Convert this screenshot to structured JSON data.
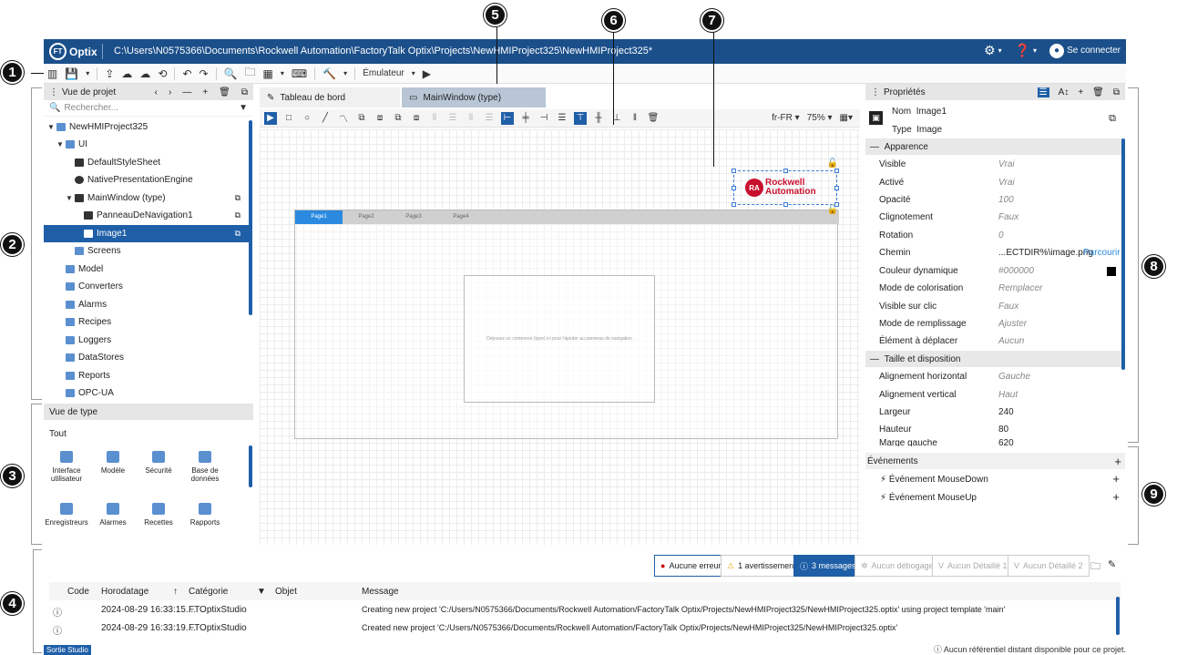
{
  "app": {
    "logo_text": "Optix",
    "logo_badge": "FT",
    "title": "C:\\Users\\N0575366\\Documents\\Rockwell Automation\\FactoryTalk Optix\\Projects\\NewHMIProject325\\NewHMIProject325*",
    "login_label": "Se connecter"
  },
  "toolbar": {
    "emulator_label": "Émulateur"
  },
  "callouts": [
    "1",
    "2",
    "3",
    "4",
    "5",
    "6",
    "7",
    "8",
    "9"
  ],
  "project_view": {
    "title": "Vue de projet",
    "search_placeholder": "Rechercher...",
    "tree": [
      {
        "label": "NewHMIProject325"
      },
      {
        "label": "UI"
      },
      {
        "label": "DefaultStyleSheet"
      },
      {
        "label": "NativePresentationEngine"
      },
      {
        "label": "MainWindow (type)"
      },
      {
        "label": "PanneauDeNavigation1"
      },
      {
        "label": "Image1"
      },
      {
        "label": "Screens"
      },
      {
        "label": "Model"
      },
      {
        "label": "Converters"
      },
      {
        "label": "Alarms"
      },
      {
        "label": "Recipes"
      },
      {
        "label": "Loggers"
      },
      {
        "label": "DataStores"
      },
      {
        "label": "Reports"
      },
      {
        "label": "OPC-UA"
      }
    ]
  },
  "type_view": {
    "title": "Vue de type",
    "filter": "Tout",
    "items": [
      {
        "label": "Interface utilisateur"
      },
      {
        "label": "Modèle"
      },
      {
        "label": "Sécurité"
      },
      {
        "label": "Base de données"
      },
      {
        "label": "Enregistreurs"
      },
      {
        "label": "Alarmes"
      },
      {
        "label": "Recettes"
      },
      {
        "label": "Rapports"
      }
    ]
  },
  "editor": {
    "tabs": [
      {
        "label": "Tableau de bord",
        "active": false
      },
      {
        "label": "MainWindow (type)",
        "active": true
      }
    ],
    "locale": "fr-FR",
    "zoom": "75%",
    "nav_tabs": [
      "Page1",
      "Page2",
      "Page3",
      "Page4"
    ],
    "drop_hint": "Déposez un conteneur (type) ici pour l'ajouter au panneau de navigation",
    "logo_line1": "Rockwell",
    "logo_line2": "Automation",
    "logo_badge": "RA"
  },
  "properties": {
    "title": "Propriétés",
    "name_label": "Nom",
    "name_value": "Image1",
    "type_label": "Type",
    "type_value": "Image",
    "group_appearance": "Apparence",
    "appearance": [
      {
        "name": "Visible",
        "value": "Vrai"
      },
      {
        "name": "Activé",
        "value": "Vrai"
      },
      {
        "name": "Opacité",
        "value": "100"
      },
      {
        "name": "Clignotement",
        "value": "Faux"
      },
      {
        "name": "Rotation",
        "value": "0"
      },
      {
        "name": "Chemin",
        "value": "...ECTDIR%\\image.png"
      },
      {
        "name": "Couleur dynamique",
        "value": "#000000"
      },
      {
        "name": "Mode de colorisation",
        "value": "Remplacer"
      },
      {
        "name": "Visible sur clic",
        "value": "Faux"
      },
      {
        "name": "Mode de remplissage",
        "value": "Ajuster"
      },
      {
        "name": "Élément à déplacer",
        "value": "Aucun"
      }
    ],
    "browse_label": "Parcourir",
    "group_layout": "Taille et disposition",
    "layout": [
      {
        "name": "Alignement horizontal",
        "value": "Gauche"
      },
      {
        "name": "Alignement vertical",
        "value": "Haut"
      },
      {
        "name": "Largeur",
        "value": "240"
      },
      {
        "name": "Hauteur",
        "value": "80"
      },
      {
        "name": "Marge gauche",
        "value": "620"
      }
    ]
  },
  "events": {
    "title": "Événements",
    "items": [
      "Événement MouseDown",
      "Événement MouseUp"
    ]
  },
  "output": {
    "filters": {
      "errors": "Aucune erreur",
      "warnings": "1 avertissement",
      "messages": "3 messages",
      "debug": "Aucun débogage",
      "verbose1": "Aucun Détaillé 1",
      "verbose2": "Aucun Détaillé 2"
    },
    "columns": {
      "code": "Code",
      "timestamp": "Horodatage",
      "category": "Catégorie",
      "object": "Objet",
      "message": "Message"
    },
    "rows": [
      {
        "timestamp": "2024-08-29 16:33:15....",
        "category": "FTOptixStudio",
        "message": "Creating new project 'C:/Users/N0575366/Documents/Rockwell Automation/FactoryTalk Optix/Projects/NewHMIProject325/NewHMIProject325.optix' using project template 'main'"
      },
      {
        "timestamp": "2024-08-29 16:33:19....",
        "category": "FTOptixStudio",
        "message": "Created new project 'C:/Users/N0575366/Documents/Rockwell Automation/FactoryTalk Optix/Projects/NewHMIProject325/NewHMIProject325.optix'"
      }
    ],
    "tab_label": "Sortie Studio",
    "remote_status": "Aucun référentiel distant disponible pour ce projet."
  }
}
